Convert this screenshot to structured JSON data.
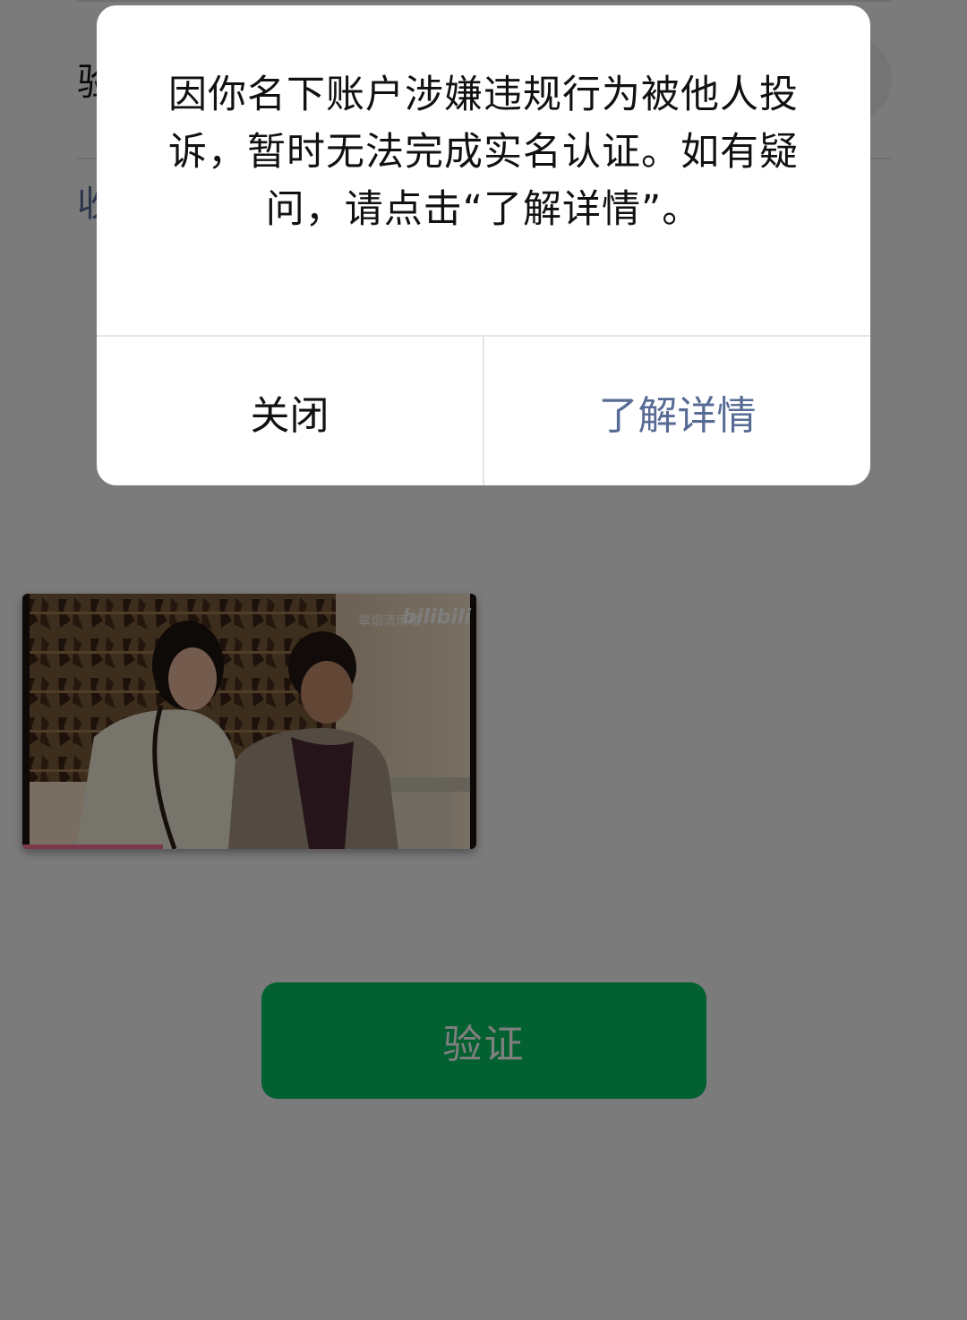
{
  "page": {
    "code_label": "验",
    "receive_link": "收",
    "verify_button": "验证"
  },
  "video": {
    "watermark": "翠烟清雨楼",
    "logo": "bilibili",
    "progress": 0.31
  },
  "dialog": {
    "message": "因你名下账户涉嫌违规行为被他人投诉，暂时无法完成实名认证。如有疑问，请点击“了解详情”。",
    "close_label": "关闭",
    "details_label": "了解详情"
  },
  "colors": {
    "accent_green": "#07c160",
    "link_blue": "#576b95",
    "bilibili_pink": "#fb7299"
  }
}
